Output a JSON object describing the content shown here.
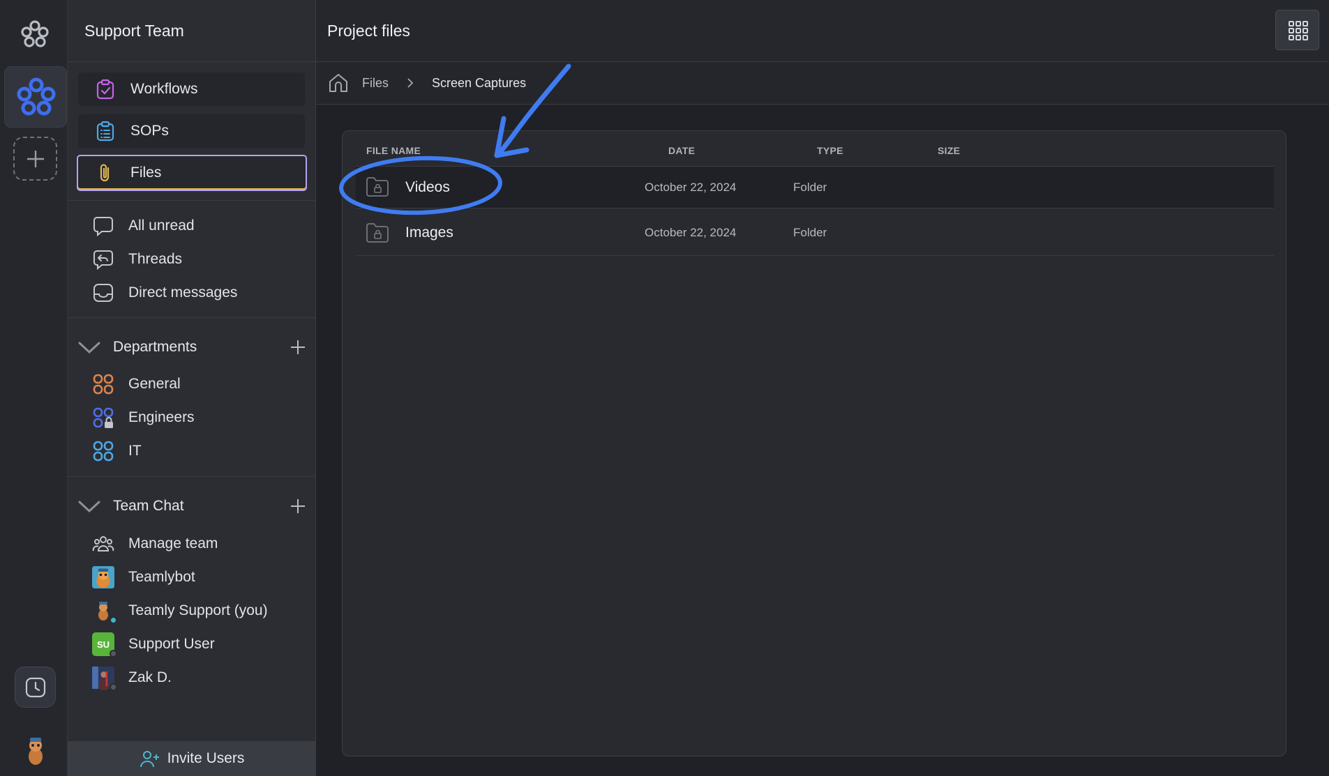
{
  "workspace": {
    "name": "Support Team"
  },
  "nav": {
    "workflows": "Workflows",
    "sops": "SOPs",
    "files": "Files"
  },
  "inbox": [
    {
      "label": "All unread",
      "icon": "chat-bubble-icon"
    },
    {
      "label": "Threads",
      "icon": "thread-icon"
    },
    {
      "label": "Direct messages",
      "icon": "inbox-icon"
    }
  ],
  "departments": {
    "title": "Departments",
    "items": [
      {
        "label": "General",
        "color": "#e0834e"
      },
      {
        "label": "Engineers",
        "color": "#4f6fe6",
        "locked": true
      },
      {
        "label": "IT",
        "color": "#4fa8e6"
      }
    ]
  },
  "team_chat": {
    "title": "Team Chat",
    "items": [
      {
        "label": "Manage team",
        "icon": "team-icon"
      },
      {
        "label": "Teamlybot",
        "icon": "bot-avatar"
      },
      {
        "label": "Teamly Support (you)",
        "icon": "user-avatar",
        "status": "#3fb6c8"
      },
      {
        "label": "Support User",
        "initials": "SU",
        "color": "#58b43a",
        "status": "#555860"
      },
      {
        "label": "Zak D.",
        "icon": "user-avatar",
        "status": "#555860"
      }
    ]
  },
  "invite": {
    "label": "Invite Users"
  },
  "main": {
    "title": "Project files",
    "breadcrumb": {
      "root": "Files",
      "current": "Screen Captures"
    },
    "columns": {
      "name": "FILE NAME",
      "date": "DATE",
      "type": "TYPE",
      "size": "SIZE"
    },
    "rows": [
      {
        "name": "Videos",
        "date": "October 22, 2024",
        "type": "Folder",
        "size": ""
      },
      {
        "name": "Images",
        "date": "October 22, 2024",
        "type": "Folder",
        "size": ""
      }
    ]
  },
  "colors": {
    "accent_blue": "#3f7cf2",
    "files_border": "#b7a2f0",
    "annotation": "#3f7cf2"
  }
}
